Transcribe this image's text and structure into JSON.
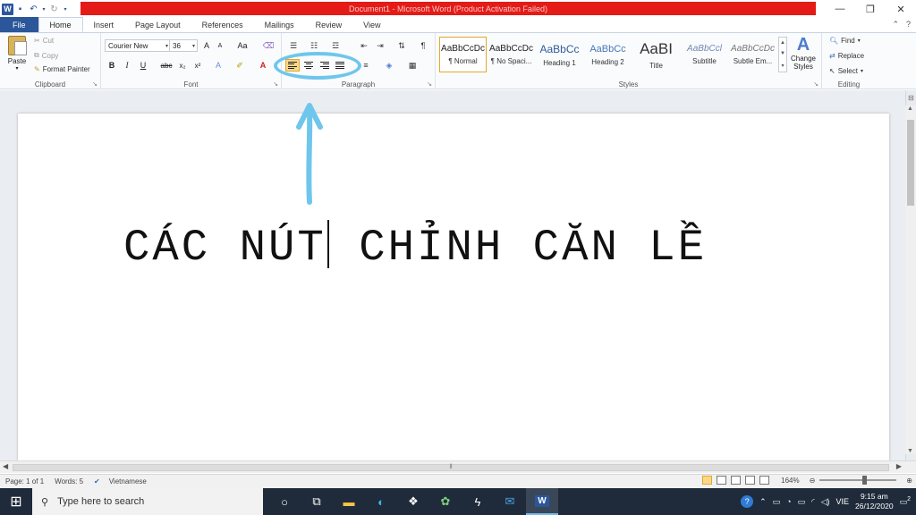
{
  "titlebar": {
    "title": "Document1 - Microsoft Word (Product Activation Failed)",
    "app_icon_letter": "W",
    "accent_red": "#e41b17",
    "word_blue": "#2b579a"
  },
  "tabs": [
    {
      "label": "File"
    },
    {
      "label": "Home"
    },
    {
      "label": "Insert"
    },
    {
      "label": "Page Layout"
    },
    {
      "label": "References"
    },
    {
      "label": "Mailings"
    },
    {
      "label": "Review"
    },
    {
      "label": "View"
    }
  ],
  "clipboard": {
    "paste": "Paste",
    "cut": "Cut",
    "copy": "Copy",
    "format_painter": "Format Painter",
    "group": "Clipboard"
  },
  "font": {
    "name": "Courier New",
    "size": "36",
    "group": "Font",
    "aa_label": "Aa",
    "grow": "A",
    "shrink": "A",
    "bold": "B",
    "italic": "I",
    "underline": "U",
    "strike": "abc",
    "subscript": "x₂",
    "superscript": "x²",
    "font_color": "A"
  },
  "paragraph": {
    "group": "Paragraph",
    "pilcrow": "¶",
    "selected_alignment": "align-left"
  },
  "styles": {
    "group": "Styles",
    "items": [
      {
        "sample": "AaBbCcDc",
        "name": "¶ Normal"
      },
      {
        "sample": "AaBbCcDc",
        "name": "¶ No Spaci..."
      },
      {
        "sample": "AaBbCc",
        "name": "Heading 1"
      },
      {
        "sample": "AaBbCc",
        "name": "Heading 2"
      },
      {
        "sample": "AaBI",
        "name": "Title"
      },
      {
        "sample": "AaBbCcl",
        "name": "Subtitle"
      },
      {
        "sample": "AaBbCcDc",
        "name": "Subtle Em..."
      }
    ],
    "change_styles": "Change",
    "change_styles_2": "Styles"
  },
  "editing": {
    "group": "Editing",
    "find": "Find",
    "replace": "Replace",
    "select": "Select"
  },
  "document": {
    "text_before_cursor": "CÁC NÚT",
    "text_after_cursor": " CHỈNH CĂN LỀ"
  },
  "statusbar": {
    "page": "Page: 1 of 1",
    "words": "Words: 5",
    "language": "Vietnamese",
    "zoom": "164%"
  },
  "taskbar": {
    "search_placeholder": "Type here to search",
    "language": "VIE",
    "time": "9:15 am",
    "date": "26/12/2020",
    "notifications": "2"
  },
  "annotation_color": "#6fc6ec"
}
